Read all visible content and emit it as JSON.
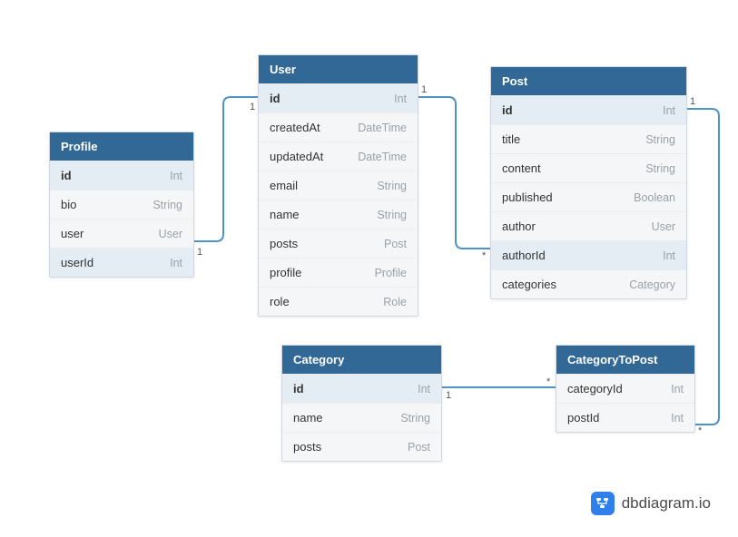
{
  "entities": {
    "profile": {
      "title": "Profile",
      "fields": [
        {
          "name": "id",
          "type": "Int",
          "pk": true
        },
        {
          "name": "bio",
          "type": "String"
        },
        {
          "name": "user",
          "type": "User"
        },
        {
          "name": "userId",
          "type": "Int",
          "hl": true
        }
      ]
    },
    "user": {
      "title": "User",
      "fields": [
        {
          "name": "id",
          "type": "Int",
          "pk": true
        },
        {
          "name": "createdAt",
          "type": "DateTime"
        },
        {
          "name": "updatedAt",
          "type": "DateTime"
        },
        {
          "name": "email",
          "type": "String"
        },
        {
          "name": "name",
          "type": "String"
        },
        {
          "name": "posts",
          "type": "Post"
        },
        {
          "name": "profile",
          "type": "Profile"
        },
        {
          "name": "role",
          "type": "Role"
        }
      ]
    },
    "post": {
      "title": "Post",
      "fields": [
        {
          "name": "id",
          "type": "Int",
          "pk": true
        },
        {
          "name": "title",
          "type": "String"
        },
        {
          "name": "content",
          "type": "String"
        },
        {
          "name": "published",
          "type": "Boolean"
        },
        {
          "name": "author",
          "type": "User"
        },
        {
          "name": "authorId",
          "type": "Int",
          "hl": true
        },
        {
          "name": "categories",
          "type": "Category"
        }
      ]
    },
    "category": {
      "title": "Category",
      "fields": [
        {
          "name": "id",
          "type": "Int",
          "pk": true
        },
        {
          "name": "name",
          "type": "String"
        },
        {
          "name": "posts",
          "type": "Post"
        }
      ]
    },
    "categoryToPost": {
      "title": "CategoryToPost",
      "fields": [
        {
          "name": "categoryId",
          "type": "Int"
        },
        {
          "name": "postId",
          "type": "Int"
        }
      ]
    }
  },
  "relationships": [
    {
      "from": "profile.userId",
      "to": "user.id",
      "fromCard": "1",
      "toCard": "1"
    },
    {
      "from": "user.id",
      "to": "post.authorId",
      "fromCard": "1",
      "toCard": "*"
    },
    {
      "from": "category.id",
      "to": "categoryToPost.categoryId",
      "fromCard": "1",
      "toCard": "*"
    },
    {
      "from": "post.id",
      "to": "categoryToPost.postId",
      "fromCard": "1",
      "toCard": "*"
    }
  ],
  "branding": {
    "text": "dbdiagram.io"
  }
}
